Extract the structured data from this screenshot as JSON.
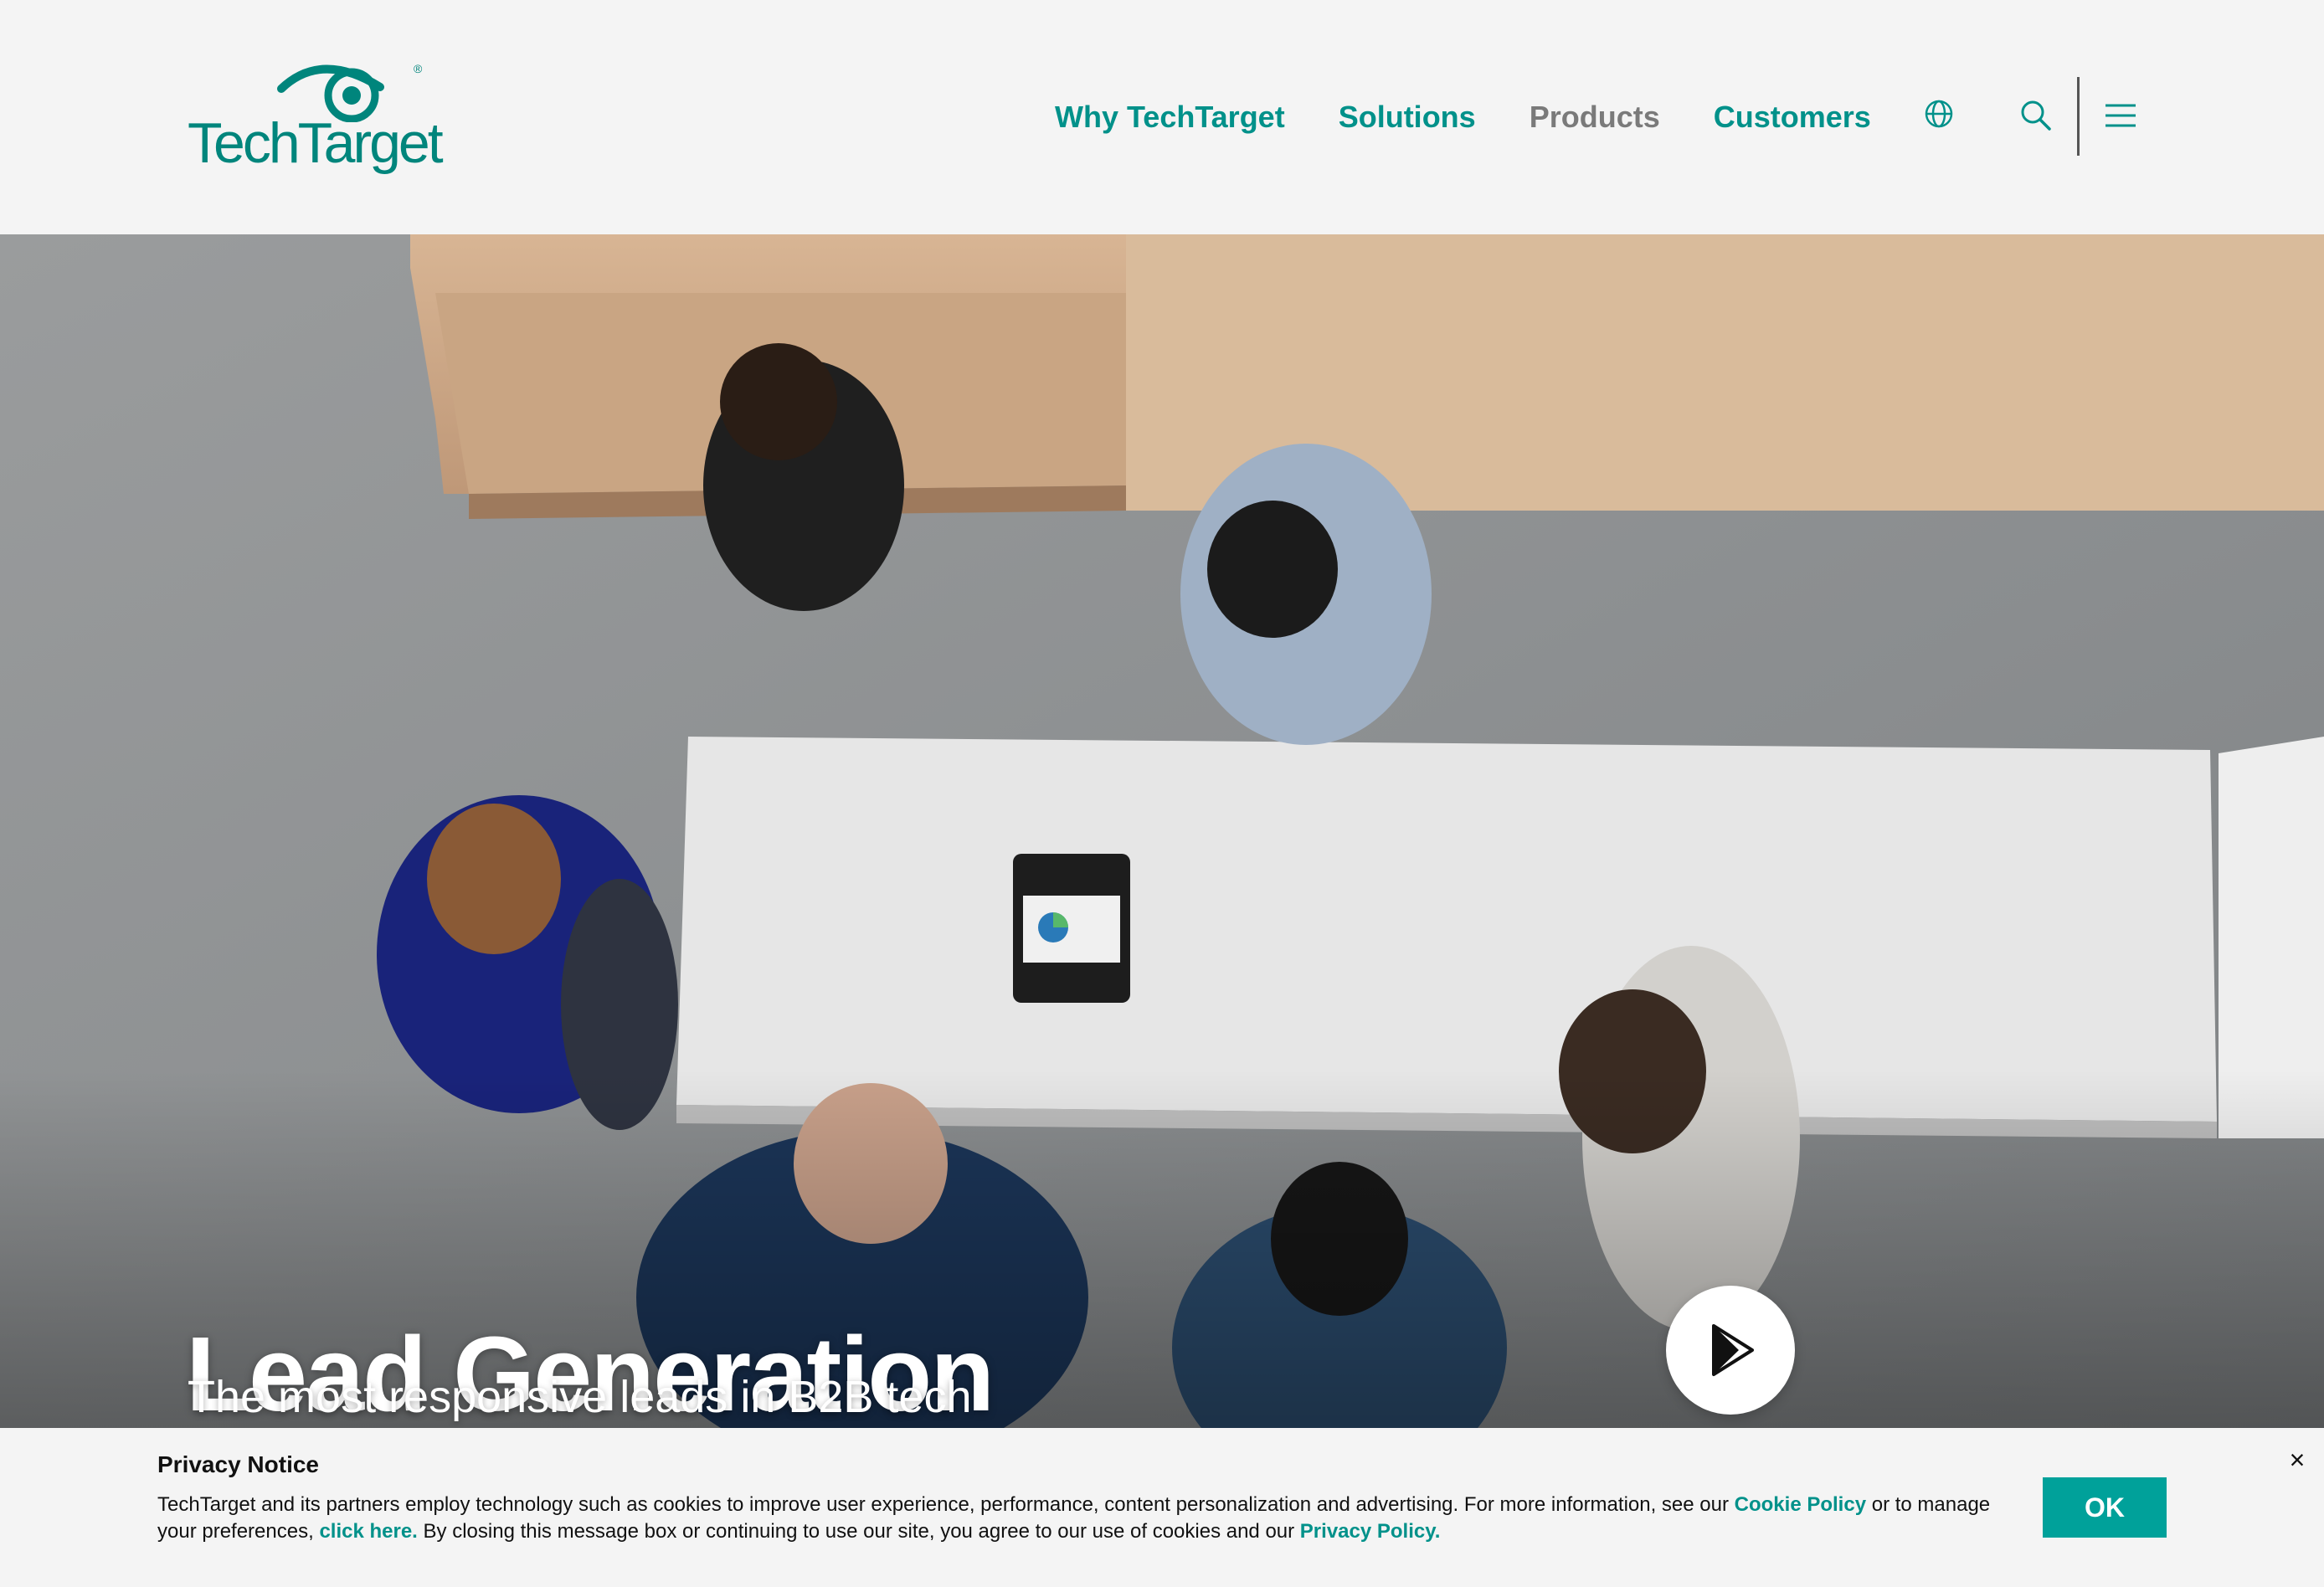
{
  "brand": {
    "name": "TechTarget",
    "registered_mark": "®",
    "primary_color": "#00857c",
    "accent_color": "#00a19a"
  },
  "nav": {
    "items": [
      {
        "label": "Why TechTarget"
      },
      {
        "label": "Solutions"
      },
      {
        "label": "Products"
      },
      {
        "label": "Customers"
      }
    ],
    "icons": [
      "globe-icon",
      "search-icon",
      "menu-icon"
    ]
  },
  "hero": {
    "title": "Lead Generation",
    "subtitle": "The most responsive leads in B2B tech",
    "play_icon": "play-icon"
  },
  "privacy": {
    "title": "Privacy Notice",
    "text_1": "TechTarget and its partners employ technology such as cookies to improve user experience, performance, content personalization and advertising. For more information, see our ",
    "link_cookie": "Cookie Policy",
    "text_2": " or to manage your preferences, ",
    "link_click": "click here.",
    "text_3": " By closing this message box or continuing to use our site, you agree to our use of cookies and our ",
    "link_privacy": "Privacy Policy.",
    "ok_label": "OK",
    "close_label": "×"
  }
}
